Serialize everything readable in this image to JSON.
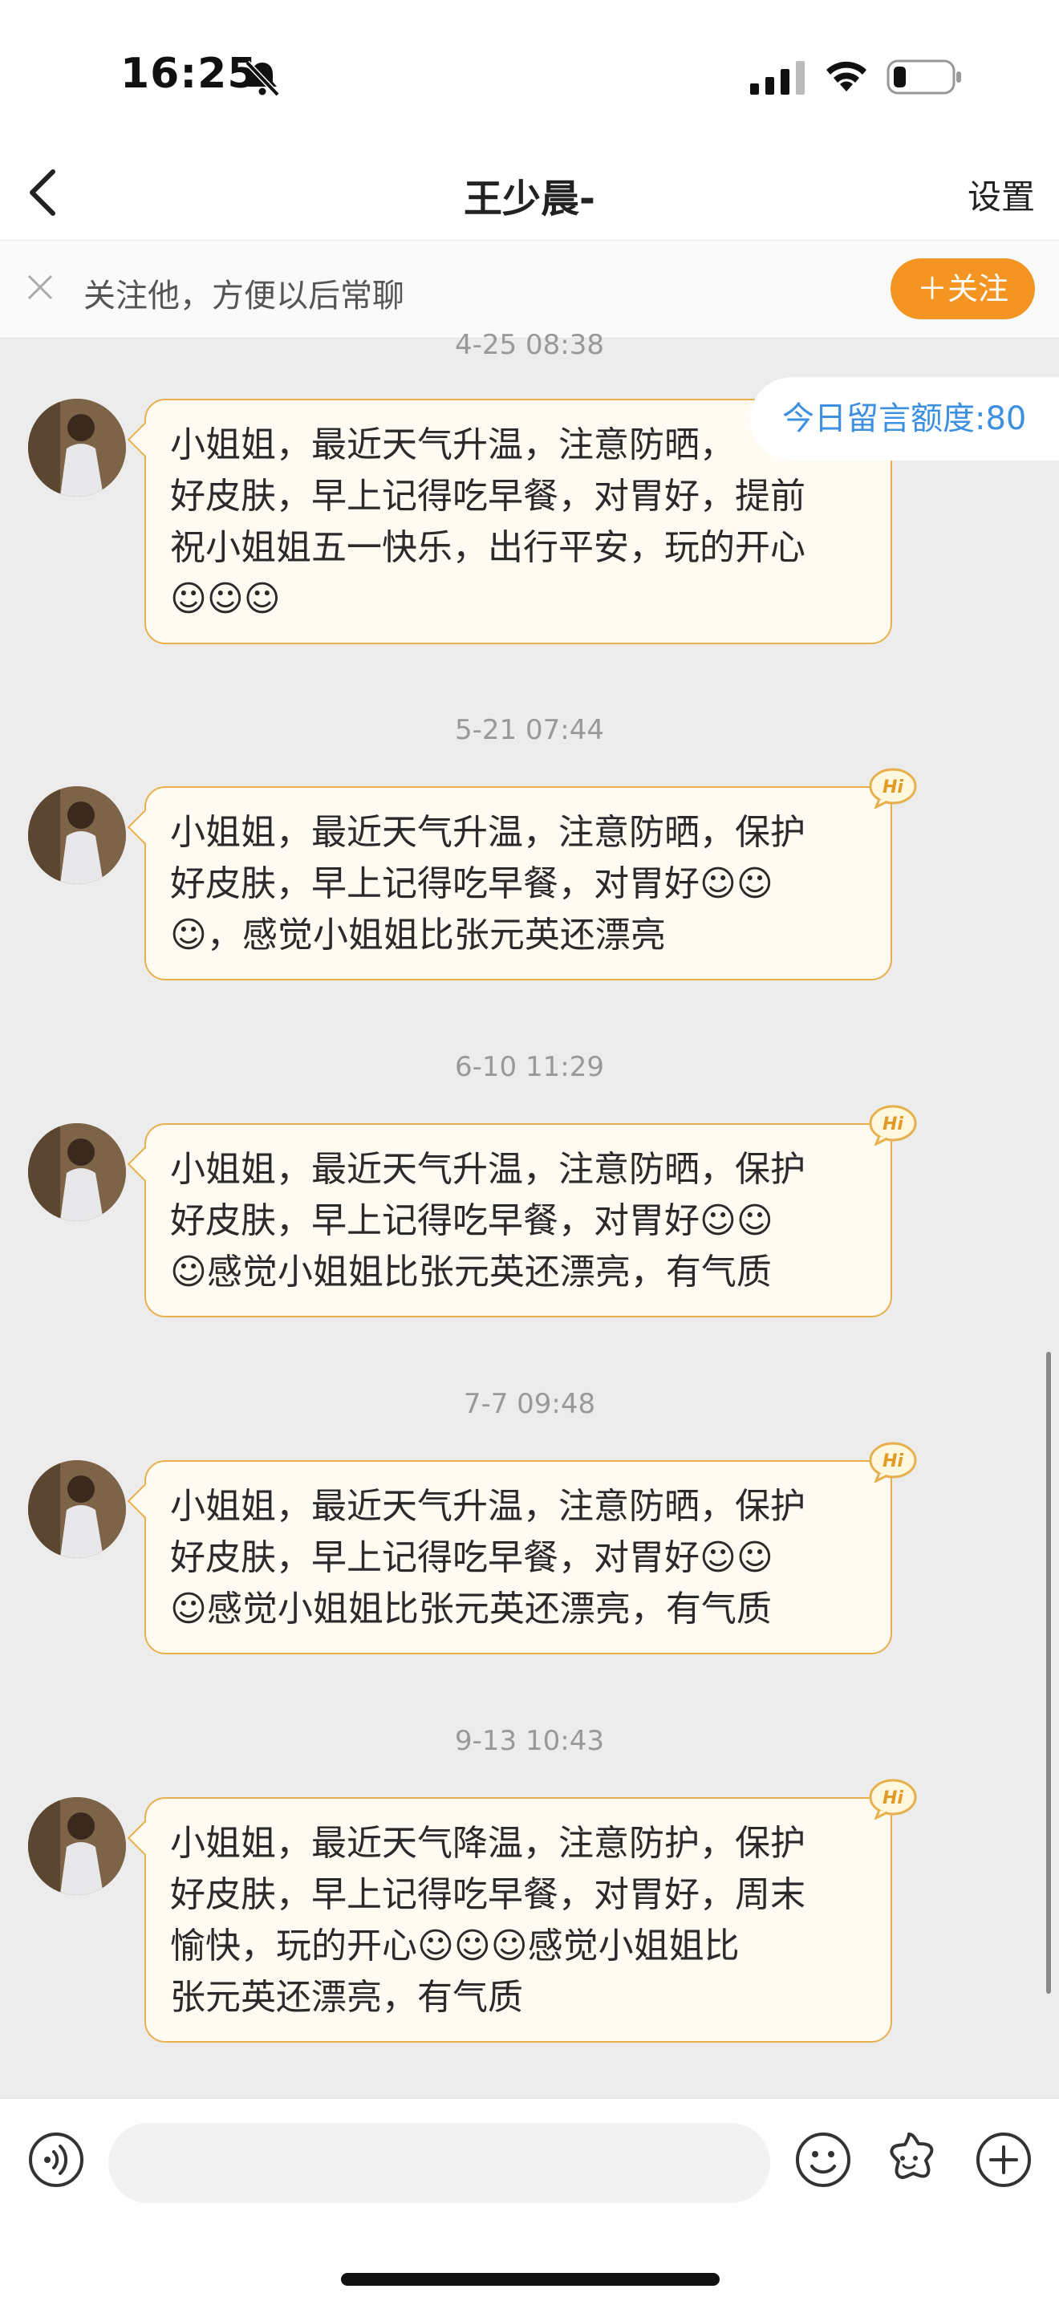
{
  "status": {
    "time": "16:25"
  },
  "header": {
    "title": "王少晨-",
    "settings_label": "设置"
  },
  "follow_bar": {
    "text": "关注他，方便以后常聊",
    "button_label": "＋关注"
  },
  "quota": "今日留言额度:80",
  "partial_timestamp": "4-25 08:38",
  "messages": [
    {
      "timestamp": "",
      "lines": [
        "小姐姐，最近天气升温，注意防晒，",
        "好皮肤，早上记得吃早餐，对胃好，提前",
        "祝小姐姐五一快乐，出行平安，玩的开心",
        "☺☺☺"
      ]
    },
    {
      "timestamp": "5-21 07:44",
      "lines": [
        "小姐姐，最近天气升温，注意防晒，保护",
        "好皮肤，早上记得吃早餐，对胃好☺☺",
        "☺，感觉小姐姐比张元英还漂亮"
      ]
    },
    {
      "timestamp": "6-10 11:29",
      "lines": [
        "小姐姐，最近天气升温，注意防晒，保护",
        "好皮肤，早上记得吃早餐，对胃好☺☺",
        "☺感觉小姐姐比张元英还漂亮，有气质"
      ]
    },
    {
      "timestamp": "7-7 09:48",
      "lines": [
        "小姐姐，最近天气升温，注意防晒，保护",
        "好皮肤，早上记得吃早餐，对胃好☺☺",
        "☺感觉小姐姐比张元英还漂亮，有气质"
      ]
    },
    {
      "timestamp": "9-13 10:43",
      "lines": [
        "小姐姐，最近天气降温，注意防护，保护",
        "好皮肤，早上记得吃早餐，对胃好，周末",
        "愉快，玩的开心☺☺☺感觉小姐姐比",
        "张元英还漂亮，有气质"
      ]
    }
  ],
  "hi_badge": "Hi",
  "colors": {
    "accent": "#f39423",
    "bubble_border": "#e8b04c",
    "bubble_bg": "#fffbf2",
    "quota_text": "#3d8fe0"
  }
}
